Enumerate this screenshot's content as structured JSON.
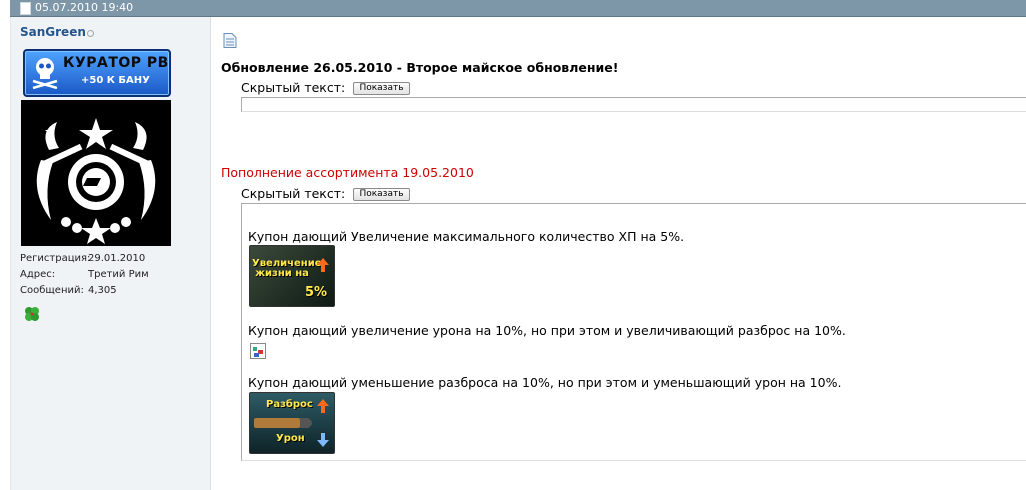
{
  "post_header": {
    "date": "05.07.2010 19:40"
  },
  "user": {
    "name": "SanGreen",
    "badge_line1": "КУРАТОР РВ",
    "badge_line2": "+50 К БАНУ",
    "info": [
      {
        "label": "Регистрация:",
        "value": "29.01.2010"
      },
      {
        "label": "Адрес:",
        "value": "Третий Рим"
      },
      {
        "label": "Сообщений:",
        "value": "4,305"
      }
    ]
  },
  "post": {
    "title1": "Обновление 26.05.2010 - Второе майское обновление!",
    "spoiler_label": "Скрытый текст:",
    "show_button": "Показать",
    "title2": "Пополнение ассортимента 19.05.2010",
    "coupons": [
      {
        "text": "Купон дающий Увеличение максимального количество ХП на 5%.",
        "img_text": "Увеличение жизни на",
        "img_value": "5%"
      },
      {
        "text": "Купон дающий увеличение урона на 10%, но при этом и увеличивающий разброс на 10%."
      },
      {
        "text": "Купон дающий уменьшение разброса на 10%, но при этом и уменьшающий урон на 10%.",
        "img_text_top": "Разброс",
        "img_text_bottom": "Урон"
      }
    ]
  },
  "colors": {
    "header_bar": "#7d96a8",
    "username": "#22558d",
    "title2": "#cc0000",
    "sidebar_bg": "#f0f3f6"
  }
}
